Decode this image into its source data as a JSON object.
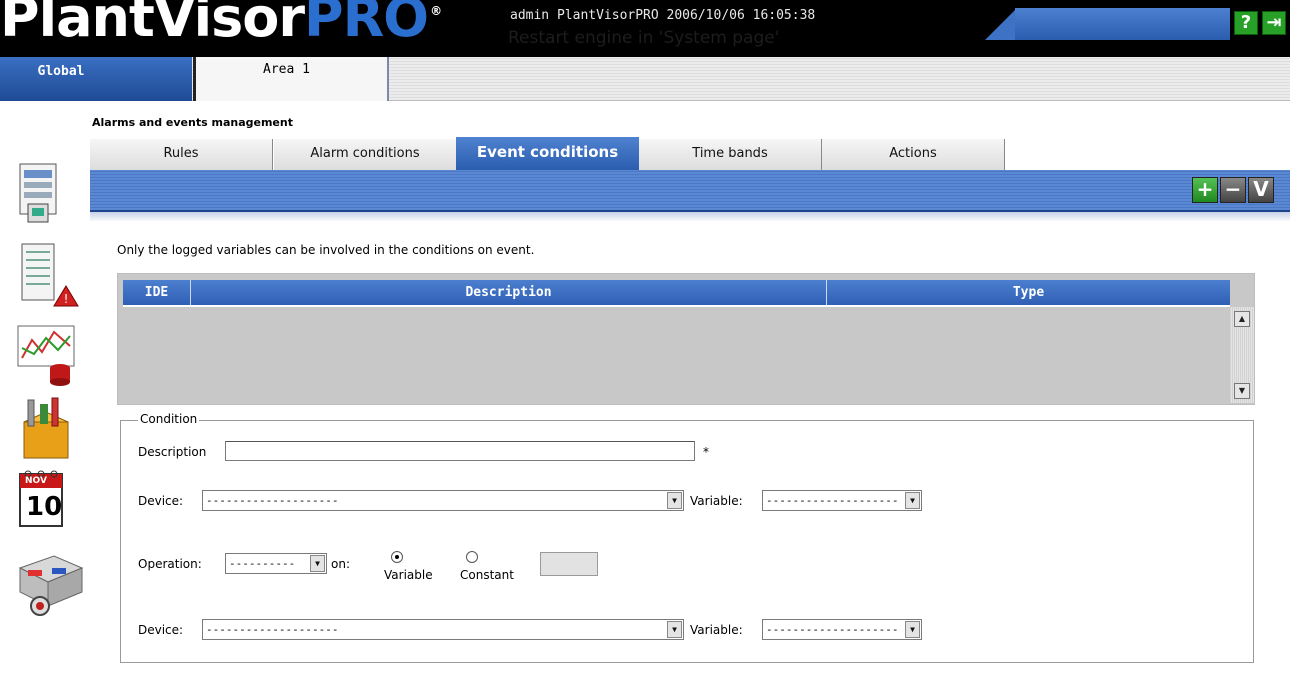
{
  "header": {
    "logo_part1": "PlantVisor",
    "logo_part2": "PRO",
    "logo_reg": "®",
    "info": "admin PlantVisorPRO 2006/10/06 16:05:38",
    "message": "Restart engine in 'System page'",
    "help_label": "?",
    "exit_label": "⇥"
  },
  "area_tabs": [
    {
      "label": "Global"
    },
    {
      "label": "Area 1"
    }
  ],
  "section_title": "Alarms and events management",
  "tabs": [
    {
      "label": "Rules"
    },
    {
      "label": "Alarm conditions"
    },
    {
      "label": "Event conditions"
    },
    {
      "label": "Time bands"
    },
    {
      "label": "Actions"
    }
  ],
  "active_tab": "Event conditions",
  "toolbar": {
    "add_label": "+",
    "remove_label": "−",
    "confirm_label": "V"
  },
  "sidebar_icons": [
    "system-icon",
    "alarm-report-icon",
    "graph-icon",
    "tools-icon",
    "calendar-icon",
    "devices-icon"
  ],
  "calendar": {
    "month": "NOV",
    "day": "10"
  },
  "info_text": "Only the logged variables can be involved in the conditions on event.",
  "table": {
    "columns": [
      "IDE",
      "Description",
      "Type"
    ],
    "rows": []
  },
  "condition": {
    "legend": "Condition",
    "description_label": "Description",
    "description_value": "",
    "required_mark": "*",
    "device1_label": "Device:",
    "device1_value": "--------------------",
    "variable1_label": "Variable:",
    "variable1_value": "--------------------",
    "operation_label": "Operation:",
    "operation_value": "----------",
    "on_label": "on:",
    "radio_variable_label": "Variable",
    "radio_constant_label": "Constant",
    "radio_selected": "Variable",
    "constant_value": "",
    "device2_label": "Device:",
    "device2_value": "--------------------",
    "variable2_label": "Variable:",
    "variable2_value": "--------------------"
  },
  "colors": {
    "accent_blue": "#2f5fb4",
    "logo_pro": "#2a6fcf",
    "add_green": "#28a028"
  }
}
